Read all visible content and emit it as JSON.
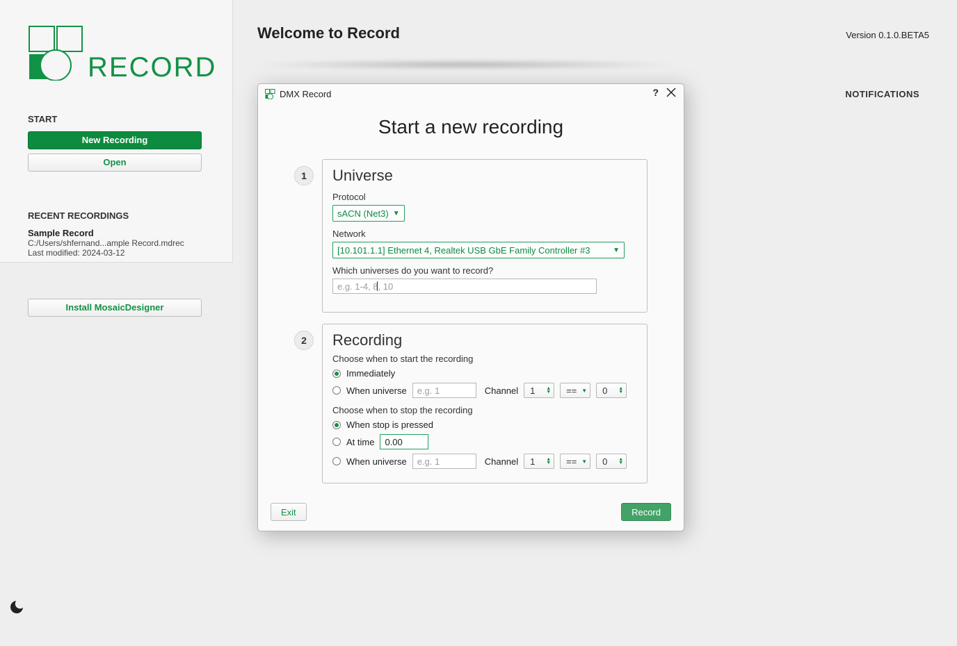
{
  "logo_text": "RECORD",
  "sidebar": {
    "start_label": "START",
    "new_recording": "New Recording",
    "open": "Open",
    "recent_label": "RECENT RECORDINGS",
    "install": "Install MosaicDesigner",
    "recent": {
      "name": "Sample Record",
      "path": "C:/Users/shfernand...ample Record.mdrec",
      "modified": "Last modified: 2024-03-12"
    }
  },
  "header": {
    "welcome": "Welcome to Record",
    "version": "Version 0.1.0.BETA5",
    "notifications": "NOTIFICATIONS"
  },
  "dialog": {
    "title": "DMX Record",
    "heading": "Start a new recording",
    "help": "?",
    "step1": {
      "num": "1",
      "title": "Universe",
      "protocol_label": "Protocol",
      "protocol_value": "sACN (Net3)",
      "network_label": "Network",
      "network_value": "[10.101.1.1] Ethernet 4, Realtek USB GbE Family Controller #3",
      "universes_label": "Which universes do you want to record?",
      "universes_placeholder": "e.g. 1-4, 8, 10"
    },
    "step2": {
      "num": "2",
      "title": "Recording",
      "start_label": "Choose when to start the recording",
      "immediately": "Immediately",
      "when_universe": "When universe",
      "when_universe_placeholder": "e.g. 1",
      "channel_label": "Channel",
      "channel_value": "1",
      "op_value": "==",
      "value_value": "0",
      "stop_label": "Choose when to stop the recording",
      "when_stop_pressed": "When stop is pressed",
      "at_time": "At time",
      "at_time_value": "0.00",
      "stop_when_universe": "When universe",
      "stop_universe_placeholder": "e.g. 1",
      "stop_channel": "Channel",
      "stop_channel_value": "1",
      "stop_op_value": "==",
      "stop_value_value": "0"
    },
    "exit_label": "Exit",
    "record_label": "Record"
  }
}
